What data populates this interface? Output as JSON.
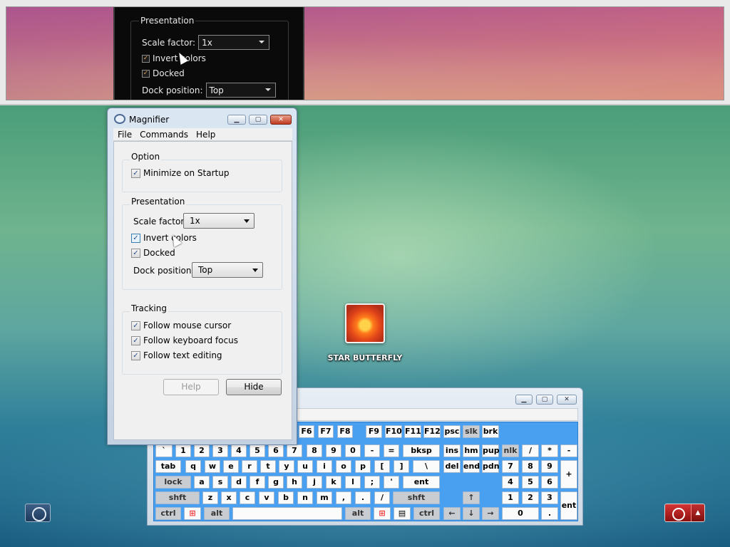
{
  "docked_view": {
    "presentation_legend": "Presentation",
    "scale_label": "Scale factor:",
    "scale_value": "1x",
    "invert_label": "Invert colors",
    "docked_label": "Docked",
    "dock_position_label": "Dock position:",
    "dock_position_value": "Top"
  },
  "magnifier": {
    "title": "Magnifier",
    "menu": [
      "File",
      "Commands",
      "Help"
    ],
    "option": {
      "legend": "Option",
      "minimize_label": "Minimize on Startup",
      "minimize_checked": true
    },
    "presentation": {
      "legend": "Presentation",
      "scale_label": "Scale factor:",
      "scale_value": "1x",
      "invert_label": "Invert colors",
      "invert_checked": true,
      "docked_label": "Docked",
      "docked_checked": true,
      "dock_position_label": "Dock position:",
      "dock_position_value": "Top"
    },
    "tracking": {
      "legend": "Tracking",
      "mouse_label": "Follow mouse cursor",
      "keyboard_label": "Follow keyboard focus",
      "text_label": "Follow text editing"
    },
    "help_button": "Help",
    "hide_button": "Hide"
  },
  "desktop_icon": {
    "label": "STAR BUTTERFLY"
  },
  "keyboard": {
    "row0": [
      "F6",
      "F7",
      "F8",
      "F9",
      "F10",
      "F11",
      "F12",
      "psc",
      "slk",
      "brk"
    ],
    "row1": [
      "`",
      "1",
      "2",
      "3",
      "4",
      "5",
      "6",
      "7",
      "8",
      "9",
      "0",
      "-",
      "=",
      "bksp",
      "ins",
      "hm",
      "pup",
      "nlk",
      "/",
      "*",
      "-"
    ],
    "row2": [
      "tab",
      "q",
      "w",
      "e",
      "r",
      "t",
      "y",
      "u",
      "i",
      "o",
      "p",
      "[",
      "]",
      "\\",
      "del",
      "end",
      "pdn",
      "7",
      "8",
      "9",
      "+"
    ],
    "row3": [
      "lock",
      "a",
      "s",
      "d",
      "f",
      "g",
      "h",
      "j",
      "k",
      "l",
      ";",
      "'",
      "ent",
      "4",
      "5",
      "6"
    ],
    "row4": [
      "shft",
      "z",
      "x",
      "c",
      "v",
      "b",
      "n",
      "m",
      ",",
      ".",
      "/",
      "shft",
      "↑",
      "1",
      "2",
      "3",
      "ent"
    ],
    "row5": [
      "ctrl",
      "",
      "alt",
      "",
      "alt",
      "",
      "",
      "ctrl",
      "←",
      "↓",
      "→",
      "0",
      "."
    ]
  },
  "colors": {
    "keyboard_bg": "#4aa0f0",
    "power_red": "#c42a2a"
  }
}
